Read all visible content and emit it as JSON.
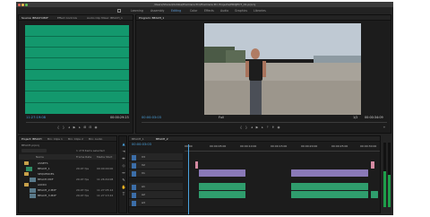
{
  "window": {
    "title": "/Users/Shared/Adobe/Premiere Pro/Premiere Pro Projects/PROJECT_01.prproj"
  },
  "workspaces": [
    {
      "label": "Learning",
      "active": false
    },
    {
      "label": "Assembly",
      "active": false
    },
    {
      "label": "Editing",
      "active": true
    },
    {
      "label": "Color",
      "active": false
    },
    {
      "label": "Effects",
      "active": false
    },
    {
      "label": "Audio",
      "active": false
    },
    {
      "label": "Graphics",
      "active": false
    },
    {
      "label": "Libraries",
      "active": false
    }
  ],
  "source_panel": {
    "tabs": [
      "Source: BEACH.MXF",
      "Effect Controls",
      "Audio Clip Mixer: BEACH_1"
    ],
    "in_timecode": "11:27:19:08",
    "out_timecode": "00:00:29:23"
  },
  "program_panel": {
    "tab": "Program: BEACH_1",
    "current_timecode": "00:00:03:03",
    "fit_label": "Full",
    "ratio_label": "1/2",
    "duration_timecode": "00:00:34:09"
  },
  "project_panel": {
    "tabs": [
      "Project: BEACH",
      "Bin: Clips 1",
      "Bin: Clips 2",
      "Bin: Audio"
    ],
    "project_file": "BEACH.prproj",
    "item_count": "1 of 8 items selected",
    "columns": [
      "Name",
      "Frame Rate",
      "Media Start"
    ],
    "items": [
      {
        "type": "folder",
        "name": "ASSETS",
        "rate": "",
        "start": ""
      },
      {
        "type": "clip",
        "name": "BEACH_1",
        "rate": "29.97 fps",
        "start": "00:00:00:00"
      },
      {
        "type": "folder",
        "name": "SEQUENCES",
        "rate": "",
        "start": ""
      },
      {
        "type": "clip",
        "name": "BEACH.MXF",
        "rate": "29.97 fps",
        "start": "11:26:49:08"
      },
      {
        "type": "folder",
        "name": "AUDIO",
        "rate": "",
        "start": ""
      },
      {
        "type": "clip",
        "name": "BEACH_2.MXF",
        "rate": "29.97 fps",
        "start": "11:27:05:14"
      },
      {
        "type": "clip",
        "name": "BEACH_3.MXF",
        "rate": "29.97 fps",
        "start": "11:27:13:22"
      }
    ]
  },
  "timeline": {
    "tabs": [
      "BEACH_1",
      "BEACH_2"
    ],
    "playhead_timecode": "00:00:03:03",
    "ruler": [
      "00:00",
      "00:00:05:00",
      "00:00:10:00",
      "00:00:15:00",
      "00:00:20:00",
      "00:00:25:00",
      "00:00:30:00"
    ],
    "tracks": [
      {
        "name": "V3"
      },
      {
        "name": "V2"
      },
      {
        "name": "V1"
      },
      {
        "name": "A1"
      },
      {
        "name": "A2"
      },
      {
        "name": "A3"
      }
    ]
  },
  "colors": {
    "accent": "#4aa3e0",
    "waveform": "#13986d",
    "video_clip": "#8a79b8",
    "audio_clip": "#2f9d6d"
  }
}
